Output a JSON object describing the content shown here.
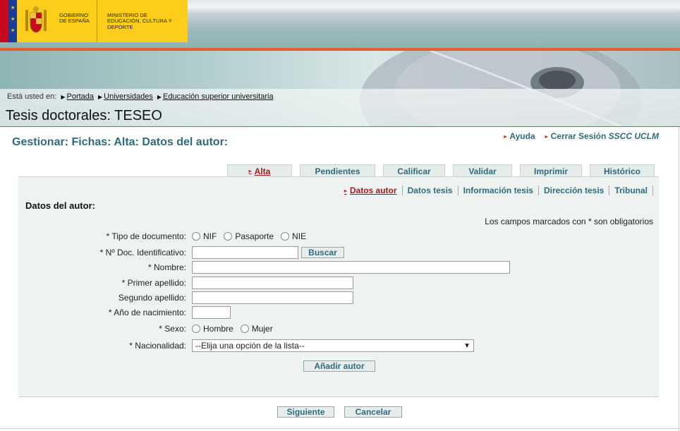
{
  "header": {
    "gov_text": "Gobierno de España",
    "ministry_text": "Ministerio de Educación, Cultura y Deporte",
    "site_title": "Tesis doctorales: TESEO"
  },
  "breadcrumb": {
    "prefix": "Está usted en:",
    "items": [
      "Portada",
      "Universidades",
      "Educación superior universitaria"
    ]
  },
  "page_title": "Gestionar: Fichas: Alta: Datos del autor:",
  "top_links": {
    "help": "Ayuda",
    "logout_prefix": "Cerrar Sesión",
    "logout_user": "SSCC UCLM"
  },
  "main_tabs": [
    {
      "label": "Alta",
      "active": true
    },
    {
      "label": "Pendientes",
      "active": false
    },
    {
      "label": "Calificar",
      "active": false
    },
    {
      "label": "Validar",
      "active": false
    },
    {
      "label": "Imprimir",
      "active": false
    },
    {
      "label": "Histórico",
      "active": false
    }
  ],
  "sub_tabs": [
    {
      "label": "Datos autor",
      "active": true
    },
    {
      "label": "Datos tesis",
      "active": false
    },
    {
      "label": "Información tesis",
      "active": false
    },
    {
      "label": "Dirección tesis",
      "active": false
    },
    {
      "label": "Tribunal",
      "active": false
    }
  ],
  "form": {
    "section_title": "Datos del autor:",
    "required_note": "Los campos marcados con * son obligatorios",
    "doc_type_label": "* Tipo de documento:",
    "doc_type_options": [
      "NIF",
      "Pasaporte",
      "NIE"
    ],
    "doc_id_label": "* Nº Doc. Identificativo:",
    "doc_id_value": "",
    "search_button": "Buscar",
    "name_label": "* Nombre:",
    "name_value": "",
    "surname1_label": "* Primer apellido:",
    "surname1_value": "",
    "surname2_label": "Segundo apellido:",
    "surname2_value": "",
    "birth_year_label": "* Año de nacimiento:",
    "birth_year_value": "",
    "sex_label": "* Sexo:",
    "sex_options": [
      "Hombre",
      "Mujer"
    ],
    "nationality_label": "* Nacionalidad:",
    "nationality_value": "--Elija una opción de la lista--",
    "add_author_button": "Añadir autor"
  },
  "footer_buttons": {
    "next": "Siguiente",
    "cancel": "Cancelar"
  },
  "colors": {
    "accent_teal": "#2e6b7c",
    "active_red": "#9e1b1b",
    "header_orange": "#e9592c",
    "logo_yellow": "#fccd1b"
  }
}
